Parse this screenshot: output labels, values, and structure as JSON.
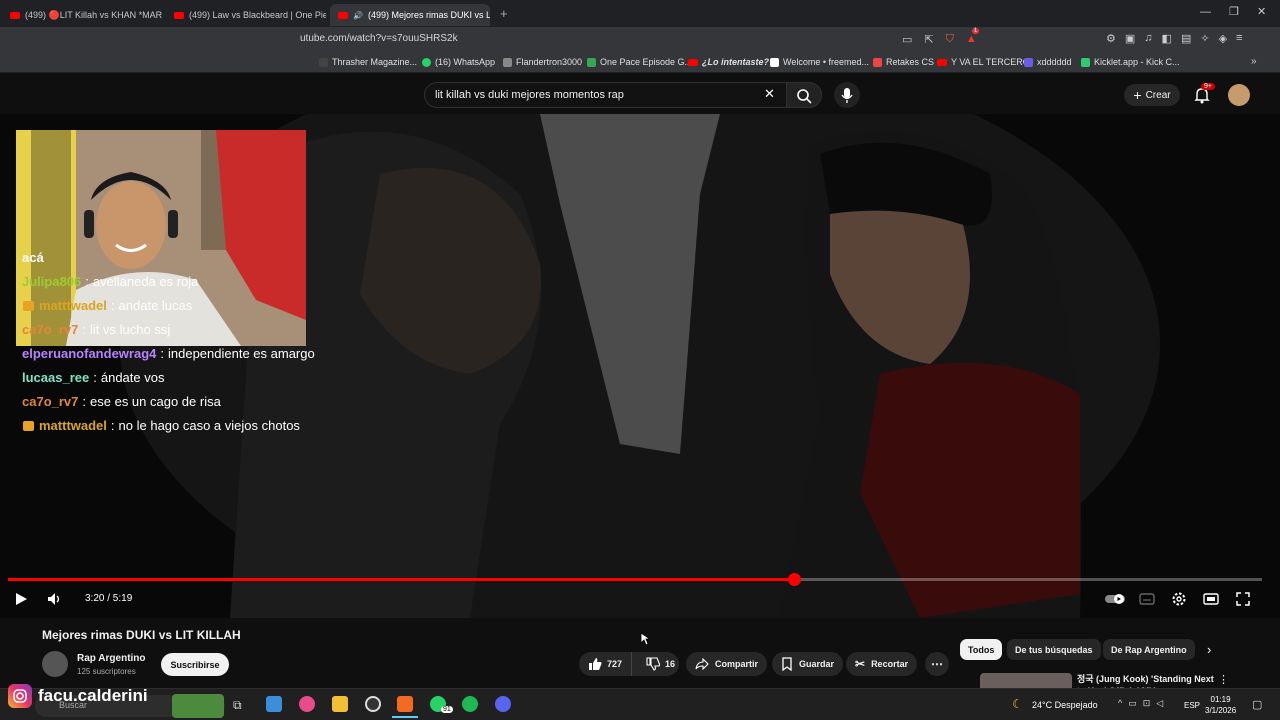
{
  "browser": {
    "tabs": [
      {
        "label": "(499) 🔴LIT Killah vs KHAN *MARBE",
        "active": false
      },
      {
        "label": "(499) Law vs Blackbeard | One Piece",
        "active": false
      },
      {
        "label": "(499) Mejores rimas DUKI vs L",
        "active": true
      }
    ],
    "url": "utube.com/watch?v=s7ouuSHRS2k",
    "bookmarks": [
      "Thrasher Magazine...",
      "(16) WhatsApp",
      "Flandertron3000",
      "One Pace Episode G...",
      "¿Lo intentaste?",
      "Welcome • freemed...",
      "Retakes CS",
      "Y VA EL TERCERO",
      "xdddddd",
      "Kicklet.app - Kick C..."
    ],
    "extension_badge": "1"
  },
  "youtube": {
    "search_query": "lit killah vs duki mejores momentos rap",
    "create_label": "Crear",
    "notifications_count": "9+"
  },
  "stream_overlay": {
    "chat": [
      {
        "user": "",
        "message": "acá",
        "color": "#ffffff",
        "badge": false
      },
      {
        "user": "Julipa806",
        "message": "avellaneda es roja",
        "color": "#9acd32",
        "badge": false
      },
      {
        "user": "matttwadel",
        "message": "andate lucas",
        "color": "#daa520",
        "badge": true
      },
      {
        "user": "ca7o_rv7",
        "message": "lit vs lucho ssj",
        "color": "#e0873b",
        "badge": false
      },
      {
        "user": "elperuanofandewrag4",
        "message": "independiente es amargo",
        "color": "#b983ff",
        "badge": false
      },
      {
        "user": "lucaas_ree",
        "message": "ándate vos",
        "color": "#7fe3c6",
        "badge": false
      },
      {
        "user": "ca7o_rv7",
        "message": "ese es un cago de risa",
        "color": "#e0873b",
        "badge": false
      },
      {
        "user": "matttwadel",
        "message": "no le hago caso a viejos chotos",
        "color": "#daa520",
        "badge": true
      }
    ],
    "instagram_handle": "facu.calderini"
  },
  "player": {
    "current_time": "3:20",
    "duration": "5:19",
    "time_display": "3:20 / 5:19",
    "progress_fraction": 0.627
  },
  "video_info": {
    "title": "Mejores rimas DUKI vs LIT KILLAH",
    "channel": "Rap Argentino",
    "subscribers": "125 suscriptores",
    "subscribe_label": "Suscribirse",
    "likes": "727",
    "dislikes": "16",
    "share_label": "Compartir",
    "save_label": "Guardar",
    "clip_label": "Recortar"
  },
  "sidebar": {
    "chips": [
      "Todos",
      "De tus búsquedas",
      "De Rap Argentino"
    ],
    "reco_title": "정국 (Jung Kook) 'Standing Next to You' Official MV"
  },
  "taskbar": {
    "search_label": "Buscar",
    "whatsapp_badge": "91",
    "weather": "24°C  Despejado",
    "language": "ESP",
    "time": "01:19",
    "date": "3/1/2026"
  }
}
